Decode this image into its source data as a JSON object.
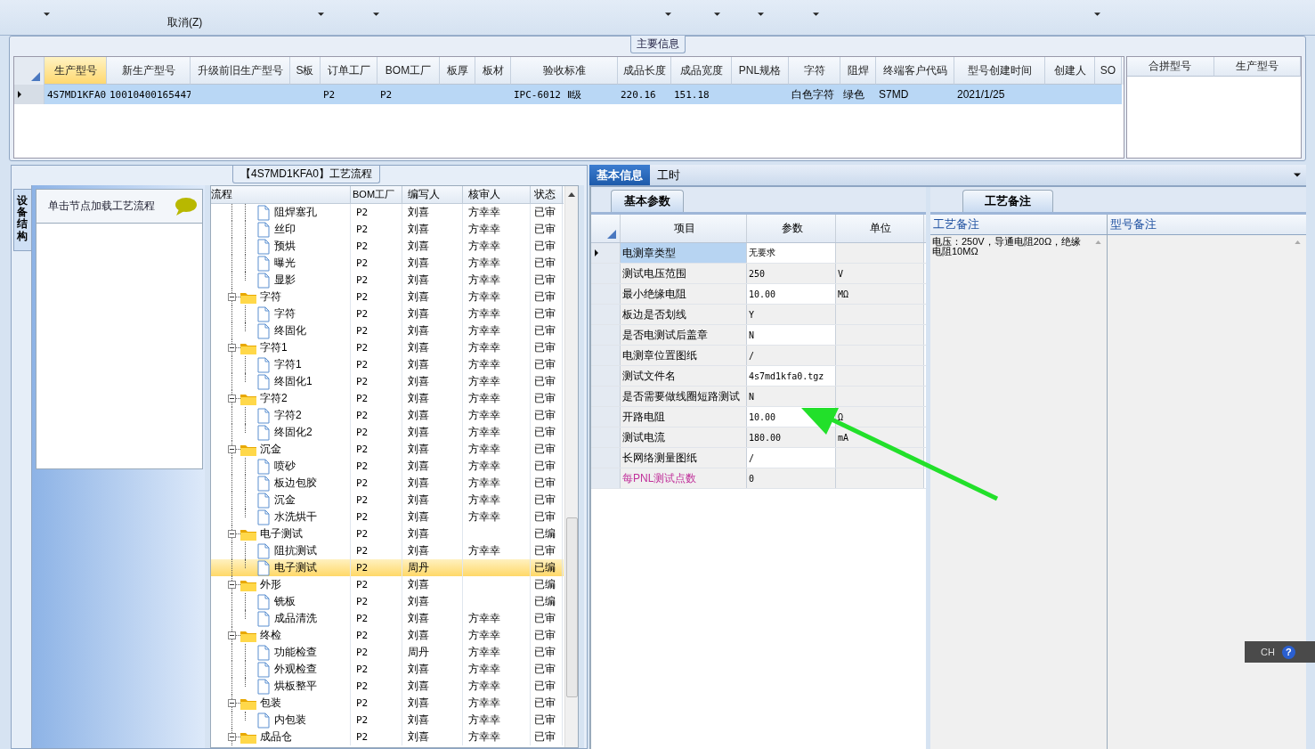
{
  "toolbar": {
    "label": "取消(Z)"
  },
  "main_info": {
    "legend": "主要信息",
    "columns": [
      {
        "label": "生产型号",
        "selected": true
      },
      {
        "label": "新生产型号",
        "selected": false
      },
      {
        "label": "升级前旧生产型号",
        "selected": false
      },
      {
        "label": "S板",
        "selected": false
      },
      {
        "label": "订单工厂",
        "selected": false
      },
      {
        "label": "BOM工厂",
        "selected": false
      },
      {
        "label": "板厚",
        "selected": false
      },
      {
        "label": "板材",
        "selected": false
      },
      {
        "label": "验收标准",
        "selected": false
      },
      {
        "label": "成品长度",
        "selected": false
      },
      {
        "label": "成品宽度",
        "selected": false
      },
      {
        "label": "PNL规格",
        "selected": false
      },
      {
        "label": "字符",
        "selected": false
      },
      {
        "label": "阻焊",
        "selected": false
      },
      {
        "label": "终端客户代码",
        "selected": false
      },
      {
        "label": "型号创建时间",
        "selected": false
      },
      {
        "label": "创建人",
        "selected": false
      },
      {
        "label": "SO",
        "selected": false
      }
    ],
    "rows": [
      {
        "selected": true,
        "cells": [
          "4S7MD1KFA0",
          "10010400165447",
          "",
          "",
          "P2",
          "P2",
          "",
          "",
          "IPC-6012 Ⅱ级",
          "220.16",
          "151.18",
          "",
          "白色字符",
          "绿色",
          "S7MD",
          "2021/1/25",
          "",
          ""
        ]
      }
    ],
    "side_columns": [
      "合拼型号",
      "生产型号"
    ]
  },
  "flow_panel": {
    "title": "【4S7MD1KFA0】工艺流程",
    "side_tab": "设备结构",
    "hint": "单击节点加载工艺流程",
    "columns": [
      "流程",
      "BOM工厂",
      "编写人",
      "核审人",
      "状态"
    ],
    "continued": [
      {
        "name": "阻焊塞孔",
        "bom": "P2",
        "writer": "刘喜",
        "reviewer": "方幸幸",
        "status": "已审",
        "selected": false
      },
      {
        "name": "丝印",
        "bom": "P2",
        "writer": "刘喜",
        "reviewer": "方幸幸",
        "status": "已审",
        "selected": false
      },
      {
        "name": "预烘",
        "bom": "P2",
        "writer": "刘喜",
        "reviewer": "方幸幸",
        "status": "已审",
        "selected": false
      },
      {
        "name": "曝光",
        "bom": "P2",
        "writer": "刘喜",
        "reviewer": "方幸幸",
        "status": "已审",
        "selected": false
      },
      {
        "name": "显影",
        "bom": "P2",
        "writer": "刘喜",
        "reviewer": "方幸幸",
        "status": "已审",
        "selected": false
      }
    ],
    "nodes": [
      {
        "name": "字符",
        "bom": "P2",
        "writer": "刘喜",
        "reviewer": "方幸幸",
        "status": "已审",
        "selected": false,
        "expanded": true,
        "children": [
          {
            "name": "字符",
            "bom": "P2",
            "writer": "刘喜",
            "reviewer": "方幸幸",
            "status": "已审",
            "selected": false
          },
          {
            "name": "终固化",
            "bom": "P2",
            "writer": "刘喜",
            "reviewer": "方幸幸",
            "status": "已审",
            "selected": false
          }
        ]
      },
      {
        "name": "字符1",
        "bom": "P2",
        "writer": "刘喜",
        "reviewer": "方幸幸",
        "status": "已审",
        "selected": false,
        "expanded": true,
        "children": [
          {
            "name": "字符1",
            "bom": "P2",
            "writer": "刘喜",
            "reviewer": "方幸幸",
            "status": "已审",
            "selected": false
          },
          {
            "name": "终固化1",
            "bom": "P2",
            "writer": "刘喜",
            "reviewer": "方幸幸",
            "status": "已审",
            "selected": false
          }
        ]
      },
      {
        "name": "字符2",
        "bom": "P2",
        "writer": "刘喜",
        "reviewer": "方幸幸",
        "status": "已审",
        "selected": false,
        "expanded": true,
        "children": [
          {
            "name": "字符2",
            "bom": "P2",
            "writer": "刘喜",
            "reviewer": "方幸幸",
            "status": "已审",
            "selected": false
          },
          {
            "name": "终固化2",
            "bom": "P2",
            "writer": "刘喜",
            "reviewer": "方幸幸",
            "status": "已审",
            "selected": false
          }
        ]
      },
      {
        "name": "沉金",
        "bom": "P2",
        "writer": "刘喜",
        "reviewer": "方幸幸",
        "status": "已审",
        "selected": false,
        "expanded": true,
        "children": [
          {
            "name": "喷砂",
            "bom": "P2",
            "writer": "刘喜",
            "reviewer": "方幸幸",
            "status": "已审",
            "selected": false
          },
          {
            "name": "板边包胶",
            "bom": "P2",
            "writer": "刘喜",
            "reviewer": "方幸幸",
            "status": "已审",
            "selected": false
          },
          {
            "name": "沉金",
            "bom": "P2",
            "writer": "刘喜",
            "reviewer": "方幸幸",
            "status": "已审",
            "selected": false
          },
          {
            "name": "水洗烘干",
            "bom": "P2",
            "writer": "刘喜",
            "reviewer": "方幸幸",
            "status": "已审",
            "selected": false
          }
        ]
      },
      {
        "name": "电子测试",
        "bom": "P2",
        "writer": "刘喜",
        "status": "已编",
        "selected": false,
        "expanded": true,
        "children": [
          {
            "name": "阻抗测试",
            "bom": "P2",
            "writer": "刘喜",
            "reviewer": "方幸幸",
            "status": "已审",
            "selected": false
          },
          {
            "name": "电子测试",
            "bom": "P2",
            "writer": "周丹",
            "status": "已编",
            "selected": true
          }
        ]
      },
      {
        "name": "外形",
        "bom": "P2",
        "writer": "刘喜",
        "status": "已编",
        "selected": false,
        "expanded": true,
        "children": [
          {
            "name": "铣板",
            "bom": "P2",
            "writer": "刘喜",
            "status": "已编",
            "selected": false
          },
          {
            "name": "成品清洗",
            "bom": "P2",
            "writer": "刘喜",
            "reviewer": "方幸幸",
            "status": "已审",
            "selected": false
          }
        ]
      },
      {
        "name": "终检",
        "bom": "P2",
        "writer": "刘喜",
        "reviewer": "方幸幸",
        "status": "已审",
        "selected": false,
        "expanded": true,
        "children": [
          {
            "name": "功能检查",
            "bom": "P2",
            "writer": "周丹",
            "reviewer": "方幸幸",
            "status": "已审",
            "selected": false
          },
          {
            "name": "外观检查",
            "bom": "P2",
            "writer": "刘喜",
            "reviewer": "方幸幸",
            "status": "已审",
            "selected": false
          },
          {
            "name": "烘板整平",
            "bom": "P2",
            "writer": "刘喜",
            "reviewer": "方幸幸",
            "status": "已审",
            "selected": false
          }
        ]
      },
      {
        "name": "包装",
        "bom": "P2",
        "writer": "刘喜",
        "reviewer": "方幸幸",
        "status": "已审",
        "selected": false,
        "expanded": true,
        "children": [
          {
            "name": "内包装",
            "bom": "P2",
            "writer": "刘喜",
            "reviewer": "方幸幸",
            "status": "已审",
            "selected": false
          }
        ]
      },
      {
        "name": "成品仓",
        "bom": "P2",
        "writer": "刘喜",
        "reviewer": "方幸幸",
        "status": "已审",
        "selected": false,
        "expanded": true
      }
    ]
  },
  "detail_tabs": [
    {
      "label": "基本信息",
      "selected": true
    },
    {
      "label": "工时",
      "selected": false
    }
  ],
  "params": {
    "tab": "基本参数",
    "columns": [
      "项目",
      "参数",
      "单位"
    ],
    "rows": [
      {
        "item": "电测章类型",
        "value": "无要求",
        "selected": true,
        "kind": "normal"
      },
      {
        "item": "测试电压范围",
        "value": "250",
        "unit": "V",
        "selected": false,
        "kind": "normal"
      },
      {
        "item": "最小绝缘电阻",
        "value": "10.00",
        "unit": "MΩ",
        "selected": false,
        "kind": "normal"
      },
      {
        "item": "板边是否划线",
        "value": "Y",
        "selected": false,
        "kind": "normal"
      },
      {
        "item": "是否电测试后盖章",
        "value": "N",
        "selected": false,
        "kind": "normal"
      },
      {
        "item": "电测章位置图纸",
        "value": "/",
        "selected": false,
        "kind": "normal"
      },
      {
        "item": "测试文件名",
        "value": "4s7md1kfa0.tgz",
        "selected": false,
        "kind": "normal"
      },
      {
        "item": "是否需要做线圈短路测试",
        "value": "N",
        "selected": false,
        "kind": "normal"
      },
      {
        "item": "开路电阻",
        "value": "10.00",
        "unit": "Ω",
        "selected": false,
        "kind": "normal"
      },
      {
        "item": "测试电流",
        "value": "180.00",
        "unit": "mA",
        "selected": false,
        "kind": "normal"
      },
      {
        "item": "长网络测量图纸",
        "value": "/",
        "selected": false,
        "kind": "normal"
      },
      {
        "item": "每PNL测试点数",
        "value": "0",
        "selected": false,
        "kind": "highlight"
      }
    ]
  },
  "remarks": {
    "tab": "工艺备注",
    "columns": [
      {
        "label": "工艺备注",
        "text": "电压：250V，导通电阻20Ω，绝缘电阻10MΩ"
      },
      {
        "label": "型号备注"
      }
    ]
  },
  "ime_bar": {
    "label": "CH",
    "help": "?"
  }
}
